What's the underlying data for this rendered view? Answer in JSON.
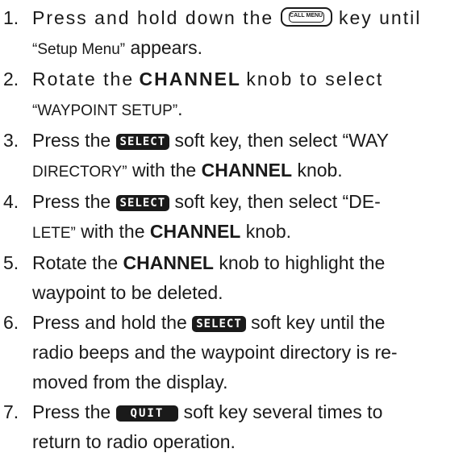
{
  "steps": [
    {
      "num": "1.",
      "a": "Press and hold down the",
      "key": "CALL MENU",
      "b": "key until",
      "c": "“Setup Menu”",
      "d": "appears."
    },
    {
      "num": "2.",
      "a": "Rotate the",
      "bold": "CHANNEL",
      "b": "knob to select",
      "c": "“WAYPOINT SETUP”",
      "d": "."
    },
    {
      "num": "3.",
      "a": "Press the",
      "softkey": "SELECT",
      "b": "soft key, then select “WAY",
      "c": "DIRECTORY”",
      "d": "with the",
      "bold": "CHANNEL",
      "e": "knob."
    },
    {
      "num": "4.",
      "a": "Press the",
      "softkey": "SELECT",
      "b": "soft key, then select “DE-",
      "c": "LETE”",
      "d": "with the",
      "bold": "CHANNEL",
      "e": "knob."
    },
    {
      "num": "5.",
      "a": "Rotate the",
      "bold": "CHANNEL",
      "b": "knob to highlight the",
      "c": "waypoint to be deleted."
    },
    {
      "num": "6.",
      "a": "Press and hold the",
      "softkey": "SELECT",
      "b": "soft key until the",
      "c": "radio beeps and the waypoint directory is re-",
      "d": "moved from the display."
    },
    {
      "num": "7.",
      "a": "Press the",
      "softkey": "QUIT",
      "b": "soft key several times to",
      "c": "return to radio operation."
    }
  ]
}
